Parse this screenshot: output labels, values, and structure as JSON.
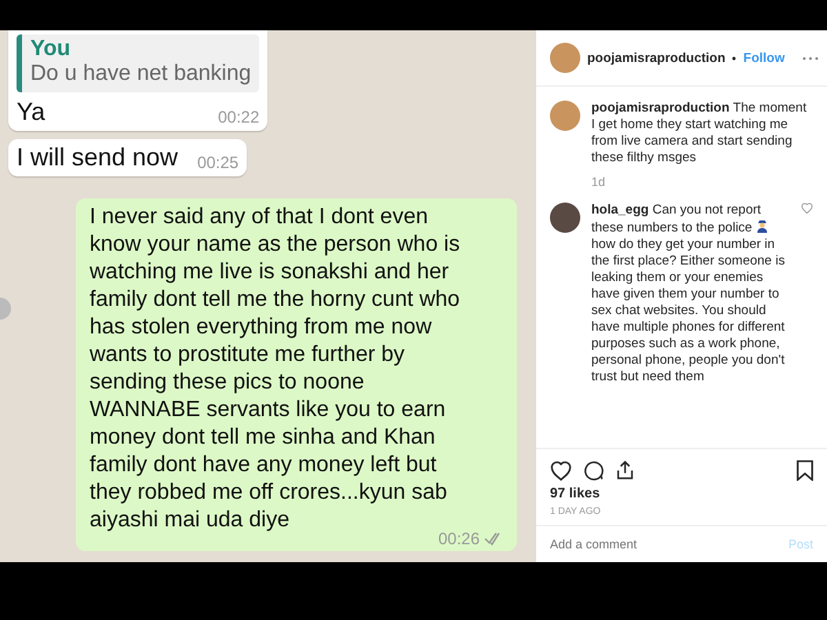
{
  "chat": {
    "messages": [
      {
        "kind": "incoming",
        "quote": {
          "author": "You",
          "text": "Do u have net banking"
        },
        "text": "Ya",
        "time": "00:22"
      },
      {
        "kind": "incoming",
        "text": "I will send now",
        "time": "00:25"
      },
      {
        "kind": "outgoing",
        "text": "I never said any of that I dont even know your name as the person who is watching me live is sonakshi and her family dont tell me the horny cunt who has stolen everything from me now wants to prostitute me further by sending these pics to noone WANNABE servants like you to earn money dont tell me sinha and  Khan family dont have any money left  but they robbed me off crores...kyun sab aiyashi mai uda diye",
        "time": "00:26"
      }
    ]
  },
  "post": {
    "author": "poojamisraproduction",
    "follow": "Follow",
    "caption": {
      "author": "poojamisraproduction",
      "text": "The moment I get home they start watching me from live camera and start sending these filthy msges",
      "age": "1d"
    },
    "comments": [
      {
        "author": "hola_egg",
        "text_before": "Can you not report these numbers to the police",
        "text_after": "how do they get your number in the first place? Either someone is leaking them or your enemies have given them your number to sex chat websites. You should have multiple phones for different purposes such as a work phone, personal phone, people you don't trust but need them",
        "liked": false
      }
    ],
    "likes": "97 likes",
    "date": "1 DAY AGO",
    "comment_placeholder": "Add a comment",
    "post_button": "Post"
  }
}
